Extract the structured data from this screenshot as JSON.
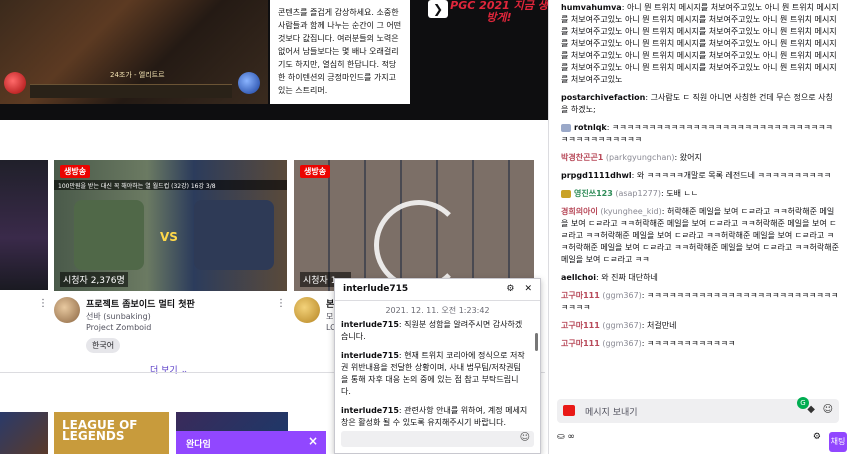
{
  "hero": {
    "text": "콘텐츠를 즐겁게 감상하세요. 소중한 사람들과 함께 나누는 순간이 그 어떤 것보다 값집니다. 여러분들의 노력은 없어서 남들보다는 몇 배나 오래걸리기도 하지만, 열심히 한답니다. 적당한 하이텐션의 긍정마인드를 가지고 있는 스트리머.",
    "level_label": "24조가 - 엘리트르",
    "next_icon": "chevron-right-icon",
    "banner_text": "PGC 2021 지금 생방게!"
  },
  "cards": [
    {
      "live_label": "생방송",
      "viewers": "시청자 2,376명",
      "overlay_text": "100만원을 받는 대신 꼭 해야하는 열 월드컵 (32강) 16강 3/8",
      "title": "프로젝트 좀보이드 멀티 첫판",
      "channel": "선바 (sunbaking)",
      "category": "Project Zomboid",
      "tag": "한국어",
      "vs": "VS"
    },
    {
      "live_label": "생방송",
      "viewers": "시청자 1,...",
      "title": "본...",
      "channel": "모...",
      "category": "LO..."
    }
  ],
  "more_label": "더 보기",
  "league_text": "LEAGUE OF LEGENDS",
  "purple_bar": {
    "label": "완다임",
    "close": "×"
  },
  "whisper": {
    "user": "interlude715",
    "timestamp": "2021. 12. 11. 오전 1:23:42",
    "messages": [
      {
        "user": "interlude715",
        "text": ": 직원분 성함을 알려주시면 감사하겠습니다."
      },
      {
        "user": "interlude715",
        "text": ": 현재 트위치 코리아에 정식으로 저작권 위반내용을 전달한 상황이며, 사내 법무팀/저작권팀을 통해 자후 대응 논의 중에 있는 점 참고 부탁드립니다."
      },
      {
        "user": "interlude715",
        "text": ": 관련사항 안내를 위하여, 계정 메세지 창은 활성화 될 수 있도록 유지해주시기 바랍니다."
      }
    ]
  },
  "chat": {
    "messages": [
      {
        "user": "humvahumva",
        "color": "#1f1f23",
        "text": "아니 뭔 트위치 메시지를 처보여주고있노 아니 뭔 트위치 메시지를 처보여주고있노 아니 뭔 트위치 메시지를 처보여주고있노 아니 뭔 트위치 메시지를 처보여주고있노 아니 뭔 트위치 메시지를 처보여주고있노 아니 뭔 트위치 메시지를 처보여주고있노 아니 뭔 트위치 메시지를 처보여주고있노 아니 뭔 트위치 메시지를 처보여주고있노 아니 뭔 트위치 메시지를 처보여주고있노 아니 뭔 트위치 메시지를 처보여주고있노 아니 뭔 트위치 메시지를 처보여주고있노 아니 뭔 트위치 메시지를 처보여주고있노"
      },
      {
        "user": "postarchivefaction",
        "color": "#1f1f23",
        "text": "그사람도 ㄷ 직원 아니면 사칭한 건데 무슨 정으로 사칭을 하겠노;"
      },
      {
        "user": "rotnlqk",
        "color": "#1f1f23",
        "text": "ㅋㅋㅋㅋㅋㅋㅋㅋㅋㅋㅋㅋㅋㅋㅋㅋㅋㅋㅋㅋㅋㅋㅋㅋㅋㅋㅋㅋㅋㅋㅋㅋㅋㅋㅋㅋㅋㅋㅋㅋㅋ"
      },
      {
        "user": "박경찬곤곤1",
        "mention": "(parkgyungchan)",
        "color": "#b84a5a",
        "text": "왔어지"
      },
      {
        "user": "prpgd1111dhwl",
        "color": "#1f1f23",
        "text": "와 ㅋㅋㅋㅋㅋ개말로 목록 레전드네 ㅋㅋㅋㅋㅋㅋㅋㅋㅋㅋ"
      },
      {
        "user": "영진쓰123",
        "mention": "(asap1277)",
        "color": "#2e8b57",
        "text": "도배 ㄴㄴ"
      },
      {
        "user": "경희의아이",
        "mention": "(kyunghee_kid)",
        "color": "#b84a5a",
        "text": "허락해준 메일을 보여 ㄷㄹ라고 ㅋㅋ허락해준 메일을 보여 ㄷㄹ라고 ㅋㅋ허락해준 메일을 보여 ㄷㄹ라고 ㅋㅋ허락해준 메일을 보여 ㄷㄹ라고 ㅋㅋ허락해준 메일을 보여 ㄷㄹ라고 ㅋㅋ허락해준 메일을 보여 ㄷㄹ라고 ㅋㅋ허락해준 메일을 보여 ㄷㄹ라고 ㅋㅋ허락해준 메일을 보여 ㄷㄹ라고 ㅋㅋ허락해준 메일을 보여 ㄷㄹ라고 ㅋㅋ"
      },
      {
        "user": "aellchoi",
        "color": "#1f1f23",
        "text": "와 진짜 대단하네"
      },
      {
        "user": "고구마111",
        "mention": "(ggm367)",
        "color": "#b84a5a",
        "text": "ㅋㅋㅋㅋㅋㅋㅋㅋㅋㅋㅋㅋㅋㅋㅋㅋㅋㅋㅋㅋㅋㅋㅋㅋㅋㅋㅋㅋㅋㅋ"
      },
      {
        "user": "고구마111",
        "mention": "(ggm367)",
        "color": "#b84a5a",
        "text": "처걸만네"
      },
      {
        "user": "고구마111",
        "mention": "(ggm367)",
        "color": "#b84a5a",
        "text": "ㅋㅋㅋㅋㅋㅋㅋㅋㅋㅋㅋㅋ"
      }
    ],
    "input_placeholder": "메시지 보내기",
    "points": "∞",
    "send_label": "채팅"
  }
}
